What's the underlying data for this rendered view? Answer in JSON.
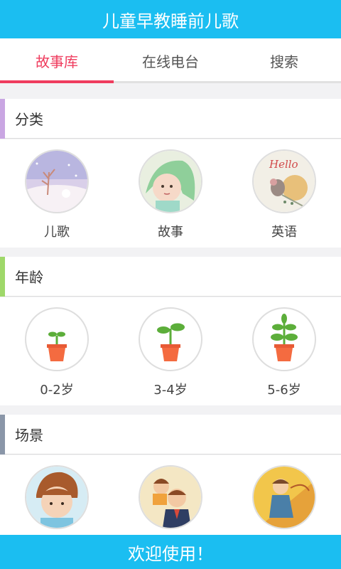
{
  "app": {
    "title": "儿童早教睡前儿歌"
  },
  "tabs": [
    {
      "label": "故事库"
    },
    {
      "label": "在线电台"
    },
    {
      "label": "搜索"
    }
  ],
  "sections": [
    {
      "title": "分类",
      "accent": "#c9a6e2",
      "items": [
        {
          "label": "儿歌",
          "icon": "winter-scene-icon"
        },
        {
          "label": "故事",
          "icon": "girl-character-icon"
        },
        {
          "label": "英语",
          "icon": "hello-mouse-icon"
        }
      ]
    },
    {
      "title": "年龄",
      "accent": "#9fd86a",
      "items": [
        {
          "label": "0-2岁",
          "icon": "small-sprout-icon"
        },
        {
          "label": "3-4岁",
          "icon": "medium-sprout-icon"
        },
        {
          "label": "5-6岁",
          "icon": "large-sprout-icon"
        }
      ]
    },
    {
      "title": "场景",
      "accent": "#8a96a8",
      "items": [
        {
          "label": "",
          "icon": "child-face-icon"
        },
        {
          "label": "",
          "icon": "father-child-icon"
        },
        {
          "label": "",
          "icon": "girl-umbrella-icon"
        }
      ]
    }
  ],
  "hello_text": "Hello",
  "footer": {
    "text": "欢迎使用！"
  },
  "colors": {
    "primary": "#1bbef1",
    "tab_active": "#ef3c5e"
  }
}
